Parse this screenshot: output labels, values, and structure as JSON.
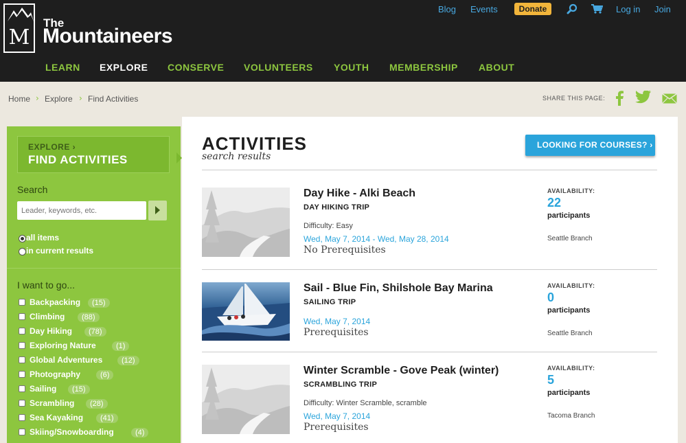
{
  "brand": {
    "logo_letter": "M",
    "small": "The",
    "big": "Mountaineers"
  },
  "utility_nav": {
    "blog": "Blog",
    "events": "Events",
    "donate": "Donate",
    "login": "Log in",
    "join": "Join"
  },
  "main_nav": [
    "LEARN",
    "EXPLORE",
    "CONSERVE",
    "VOLUNTEERS",
    "YOUTH",
    "MEMBERSHIP",
    "ABOUT"
  ],
  "breadcrumb": [
    "Home",
    "Explore",
    "Find Activities"
  ],
  "share": {
    "label": "SHARE THIS PAGE:"
  },
  "sidebar": {
    "kicker": "EXPLORE ›",
    "title": "FIND ACTIVITIES",
    "search_label": "Search",
    "search_placeholder": "Leader, keywords, etc.",
    "radio_all": "all items",
    "radio_current": "in current results",
    "want_label": "I want to go...",
    "categories": [
      {
        "label": "Backpacking",
        "count": "(15)"
      },
      {
        "label": "Climbing",
        "count": "(88)"
      },
      {
        "label": "Day Hiking",
        "count": "(78)"
      },
      {
        "label": "Exploring Nature",
        "count": "(1)"
      },
      {
        "label": "Global Adventures",
        "count": "(12)"
      },
      {
        "label": "Photography",
        "count": "(6)"
      },
      {
        "label": "Sailing",
        "count": "(15)"
      },
      {
        "label": "Scrambling",
        "count": "(28)"
      },
      {
        "label": "Sea Kayaking",
        "count": "(41)"
      },
      {
        "label": "Skiing/Snowboarding",
        "count": "(4)"
      }
    ]
  },
  "main": {
    "title": "ACTIVITIES",
    "subtitle": "search results",
    "courses_button": "LOOKING FOR COURSES? ›",
    "items": [
      {
        "title": "Day Hike - Alki Beach",
        "type": "DAY HIKING TRIP",
        "difficulty": "Difficulty: Easy",
        "date": "Wed, May 7, 2014 - Wed, May 28, 2014",
        "prereq": "No Prerequisites",
        "availability_label": "AVAILABILITY:",
        "availability": "22",
        "participants": "participants",
        "branch": "Seattle Branch"
      },
      {
        "title": "Sail - Blue Fin, Shilshole Bay Marina",
        "type": "SAILING TRIP",
        "difficulty": "",
        "date": "Wed, May 7, 2014",
        "prereq": "Prerequisites",
        "availability_label": "AVAILABILITY:",
        "availability": "0",
        "participants": "participants",
        "branch": "Seattle Branch"
      },
      {
        "title": "Winter Scramble - Gove Peak (winter)",
        "type": "SCRAMBLING TRIP",
        "difficulty": "Difficulty: Winter Scramble, scramble",
        "date": "Wed, May 7, 2014",
        "prereq": "Prerequisites",
        "availability_label": "AVAILABILITY:",
        "availability": "5",
        "participants": "participants",
        "branch": "Tacoma Branch"
      }
    ]
  },
  "colors": {
    "green": "#8dc63f",
    "blue": "#2aa4db",
    "dark": "#1e1e1e",
    "donate": "#f2b53b"
  }
}
